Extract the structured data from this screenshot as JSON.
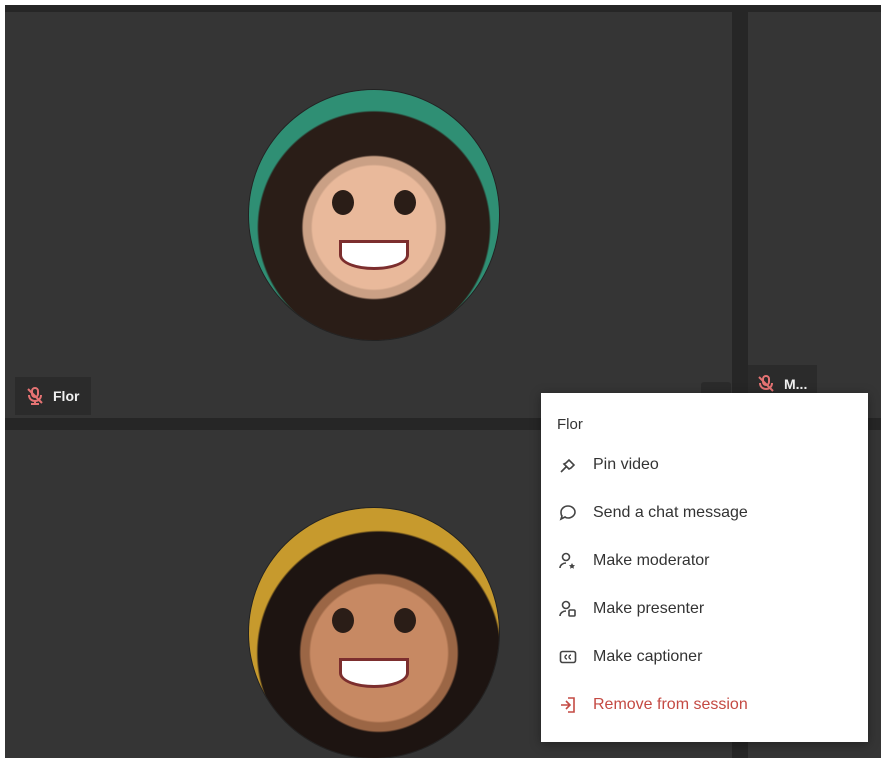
{
  "participants": {
    "flor": {
      "name": "Flor",
      "mic": "muted"
    },
    "right_tile": {
      "name": "M..."
    }
  },
  "menu": {
    "title": "Flor",
    "items": [
      {
        "label": "Pin video",
        "icon": "pin-icon"
      },
      {
        "label": "Send a chat message",
        "icon": "chat-bubble-icon"
      },
      {
        "label": "Make moderator",
        "icon": "moderator-icon"
      },
      {
        "label": "Make presenter",
        "icon": "presenter-icon"
      },
      {
        "label": "Make captioner",
        "icon": "captioner-icon"
      },
      {
        "label": "Remove from session",
        "icon": "remove-icon"
      }
    ]
  },
  "colors": {
    "tile_bg": "#353535",
    "danger": "#c44a43",
    "muted_mic": "#e57373"
  }
}
